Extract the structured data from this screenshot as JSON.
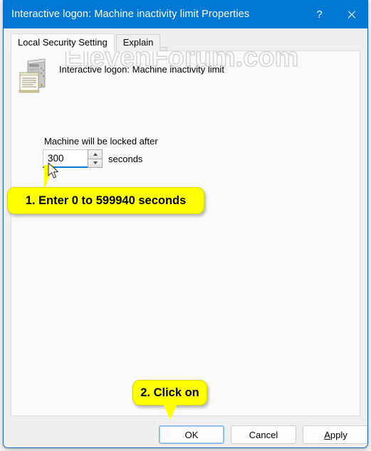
{
  "window": {
    "title": "Interactive logon: Machine inactivity limit Properties",
    "help_label": "?",
    "close_label": "✕"
  },
  "tabs": [
    {
      "label": "Local Security Setting",
      "selected": true
    },
    {
      "label": "Explain",
      "selected": false
    }
  ],
  "policy": {
    "icon": "server-policy-icon",
    "name": "Interactive logon: Machine inactivity limit"
  },
  "setting": {
    "label": "Machine will be locked after",
    "value": "300",
    "placeholder": "",
    "unit": "seconds",
    "spin_up_icon": "chevron-up-icon",
    "spin_down_icon": "chevron-down-icon"
  },
  "footer": {
    "ok_label": "OK",
    "cancel_label": "Cancel",
    "apply_prefix": "A",
    "apply_rest": "pply"
  },
  "watermark": {
    "text": "ElevenForum.com"
  },
  "callouts": [
    {
      "text": "1. Enter 0 to 599940 seconds"
    },
    {
      "text": "2. Click on"
    }
  ],
  "colors": {
    "titlebar": "#0078d4",
    "accent": "#0078d4",
    "callout": "#ffff00",
    "dialog": "#efefef",
    "panel": "#fafafa"
  }
}
